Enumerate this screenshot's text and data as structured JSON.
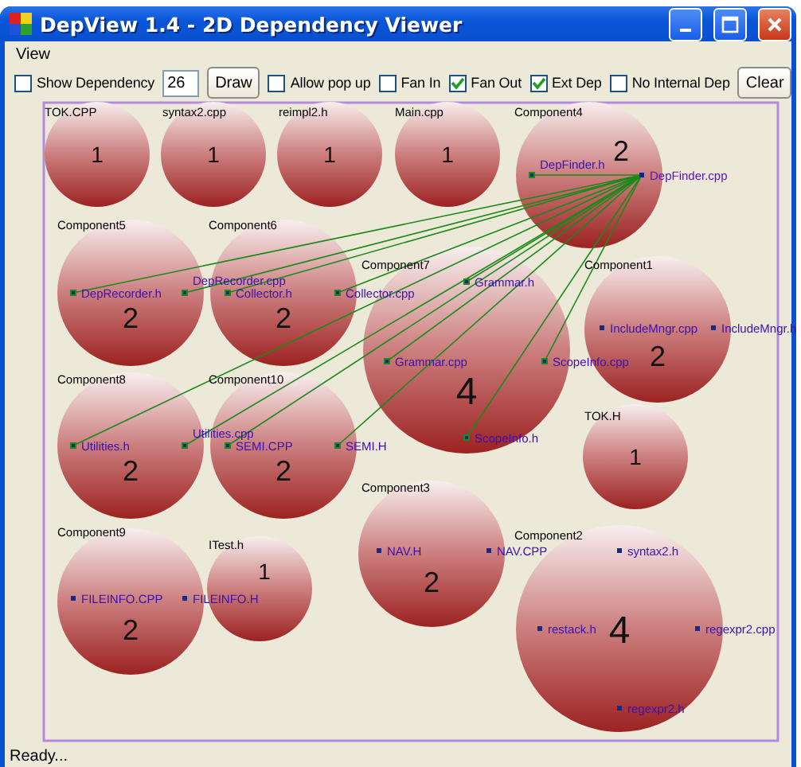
{
  "window": {
    "title": "DepView 1.4 - 2D Dependency Viewer"
  },
  "menu": [
    {
      "label": "View"
    }
  ],
  "toolbar": [
    {
      "kind": "checkbox",
      "label": "Show Dependency",
      "checked": false
    },
    {
      "kind": "field",
      "value": "26"
    },
    {
      "kind": "button",
      "label": "Draw"
    },
    {
      "kind": "checkbox",
      "label": "Allow pop up",
      "checked": false
    },
    {
      "kind": "checkbox",
      "label": "Fan In",
      "checked": false
    },
    {
      "kind": "checkbox",
      "label": "Fan Out",
      "checked": true
    },
    {
      "kind": "checkbox",
      "label": "Ext Dep",
      "checked": true
    },
    {
      "kind": "checkbox",
      "label": "No Internal Dep",
      "checked": false
    },
    {
      "kind": "button",
      "label": "Clear"
    }
  ],
  "components": [
    {
      "label": "TOK.CPP",
      "count": "1"
    },
    {
      "label": "syntax2.cpp",
      "count": "1"
    },
    {
      "label": "reimpl2.h",
      "count": "1"
    },
    {
      "label": "Main.cpp",
      "count": "1"
    },
    {
      "label": "Component4",
      "count": "2",
      "files": [
        {
          "name": "DepFinder.h",
          "kind": "file",
          "linked": true
        },
        {
          "name": "DepFinder.cpp",
          "kind": "source",
          "linked": false
        }
      ]
    },
    {
      "label": "Component5",
      "count": "2",
      "files": [
        {
          "name": "DepRecorder.h",
          "kind": "file",
          "linked": true
        },
        {
          "name": "DepRecorder.cpp",
          "kind": "file",
          "linked": true
        }
      ]
    },
    {
      "label": "Component6",
      "count": "2",
      "files": [
        {
          "name": "Collector.h",
          "kind": "file",
          "linked": true
        },
        {
          "name": "Collector.cpp",
          "kind": "file",
          "linked": true
        }
      ]
    },
    {
      "label": "Component7",
      "count": "4",
      "files": [
        {
          "name": "Grammar.h",
          "kind": "file",
          "linked": true
        },
        {
          "name": "Grammar.cpp",
          "kind": "file",
          "linked": true
        },
        {
          "name": "ScopeInfo.cpp",
          "kind": "file",
          "linked": true
        },
        {
          "name": "ScopeInfo.h",
          "kind": "file",
          "linked": true
        }
      ]
    },
    {
      "label": "Component1",
      "count": "2",
      "files": [
        {
          "name": "IncludeMngr.cpp",
          "kind": "file",
          "linked": false
        },
        {
          "name": "IncludeMngr.h",
          "kind": "file",
          "linked": false
        }
      ]
    },
    {
      "label": "Component8",
      "count": "2",
      "files": [
        {
          "name": "Utilities.h",
          "kind": "file",
          "linked": true
        },
        {
          "name": "Utilities.cpp",
          "kind": "file",
          "linked": true
        }
      ]
    },
    {
      "label": "Component10",
      "count": "2",
      "files": [
        {
          "name": "SEMI.CPP",
          "kind": "file",
          "linked": true
        },
        {
          "name": "SEMI.H",
          "kind": "file",
          "linked": true
        }
      ]
    },
    {
      "label": "TOK.H",
      "count": "1"
    },
    {
      "label": "Component3",
      "count": "2",
      "files": [
        {
          "name": "NAV.H",
          "kind": "file",
          "linked": false
        },
        {
          "name": "NAV.CPP",
          "kind": "file",
          "linked": false
        }
      ]
    },
    {
      "label": "Component9",
      "count": "2",
      "files": [
        {
          "name": "FILEINFO.CPP",
          "kind": "file",
          "linked": false
        },
        {
          "name": "FILEINFO.H",
          "kind": "file",
          "linked": false
        }
      ]
    },
    {
      "label": "ITest.h",
      "count": "1"
    },
    {
      "label": "Component2",
      "count": "4",
      "files": [
        {
          "name": "syntax2.h",
          "kind": "file",
          "linked": false
        },
        {
          "name": "restack.h",
          "kind": "file",
          "linked": false
        },
        {
          "name": "regexpr2.cpp",
          "kind": "file",
          "linked": false
        },
        {
          "name": "regexpr2.h",
          "kind": "file",
          "linked": false
        }
      ]
    }
  ],
  "status_bar": {
    "text": "Ready..."
  }
}
